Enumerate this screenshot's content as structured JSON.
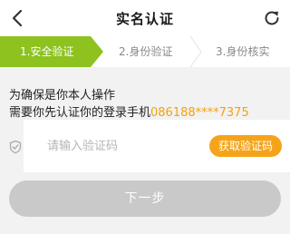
{
  "header": {
    "title": "实名认证",
    "back_icon": "chevron-left-icon",
    "refresh_icon": "refresh-icon"
  },
  "steps": [
    {
      "label": "1.安全验证",
      "active": true
    },
    {
      "label": "2.身份验证",
      "active": false
    },
    {
      "label": "3.身份核实",
      "active": false
    }
  ],
  "colors": {
    "accent_green": "#8dc21f",
    "accent_orange": "#f5a41a",
    "phone_text": "#f5a10c",
    "disabled_button": "#c9c9c9"
  },
  "tip": {
    "line1": "为确保是你本人操作",
    "line2_prefix": "需要你先认证你的登录手机",
    "phone": "086188****7375"
  },
  "code": {
    "icon": "shield-check-icon",
    "placeholder": "请输入验证码",
    "value": "",
    "get_code_label": "获取验证码"
  },
  "next_label": "下一步"
}
